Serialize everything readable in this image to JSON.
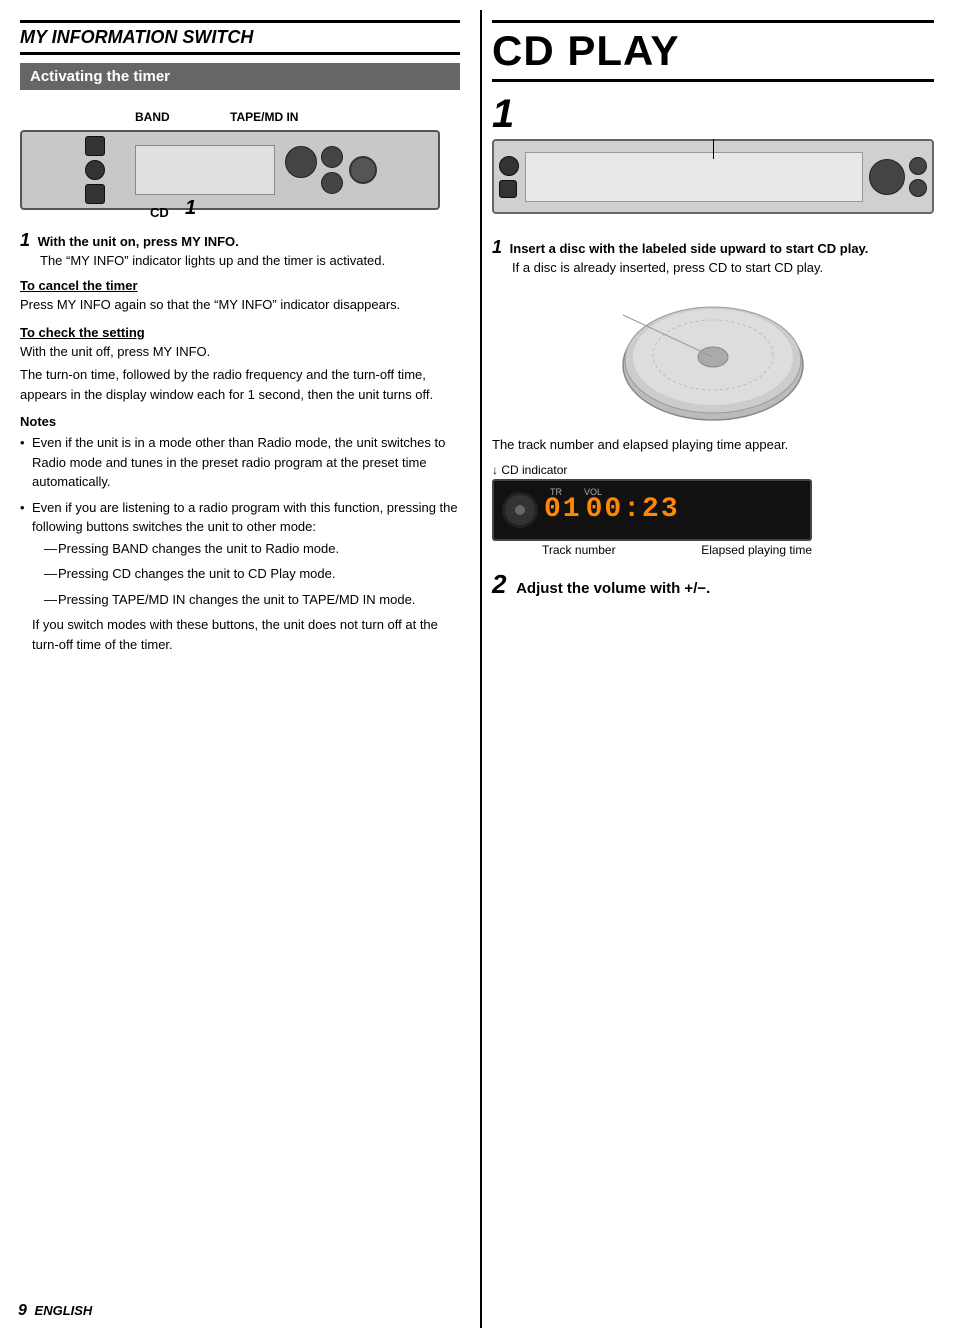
{
  "left": {
    "section_title": "MY INFORMATION SWITCH",
    "activating_banner": "Activating the timer",
    "band_label": "BAND",
    "tapemd_label": "TAPE/MD IN",
    "cd_label": "CD",
    "cd_step_num": "1",
    "step1_num": "1",
    "step1_bold": "With the unit on, press MY INFO.",
    "step1_body": "The “MY INFO” indicator lights up and the timer is activated.",
    "cancel_heading": "To cancel the timer",
    "cancel_body": "Press MY INFO again so that the “MY INFO” indicator disappears.",
    "check_heading": "To check the setting",
    "check_body1": "With the unit off, press MY INFO.",
    "check_body2": "The turn-on time, followed by the radio frequency and the turn-off time, appears in the display window each for 1 second, then the unit turns off.",
    "notes_heading": "Notes",
    "notes": [
      {
        "text": "Even if the unit is in a mode other than Radio mode, the unit switches to Radio mode and tunes in the preset radio program at the preset time automatically.",
        "subitems": []
      },
      {
        "text": "Even if you are listening to a radio program with this function, pressing the following buttons switches the unit to other mode:",
        "subitems": [
          "Pressing BAND changes the unit to Radio mode.",
          "Pressing CD changes the unit to CD Play mode.",
          "Pressing TAPE/MD IN changes the unit to TAPE/MD IN mode."
        ]
      }
    ],
    "notes_tail": "If you switch modes with these buttons, the unit does not turn off at the turn-off time of the timer."
  },
  "right": {
    "section_title": "CD PLAY",
    "big_step1": "1",
    "step1_bold": "Insert a disc with the labeled side upward to start CD play.",
    "step1_body": "If a disc is already inserted, press CD to start CD play.",
    "appear_text": "The track number and elapsed playing time appear.",
    "cd_indicator_label": "CD indicator",
    "track_label": "Track number",
    "elapsed_label": "Elapsed playing time",
    "track_num": "01",
    "elapsed_time": "00:23",
    "big_step2": "2",
    "step2_text": "Adjust the volume with +/−."
  },
  "footer": {
    "page_num": "9",
    "language": "ENGLISH"
  }
}
